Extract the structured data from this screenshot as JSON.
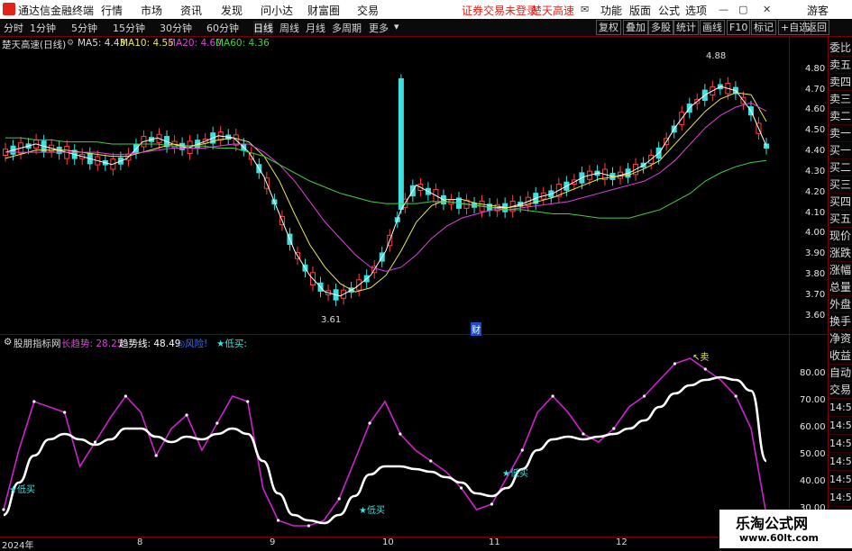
{
  "app": {
    "title": "通达信金融终端",
    "menu": [
      "行情",
      "市场",
      "资讯",
      "发现",
      "问小达",
      "财富圈",
      "交易"
    ],
    "trade_status": "证券交易未登录",
    "stock_name_top": "楚天高速",
    "right_menu": [
      "功能",
      "版面",
      "公式",
      "选项"
    ],
    "user": "游客"
  },
  "toolbar": {
    "periods": [
      "分时",
      "1分钟",
      "5分钟",
      "15分钟",
      "30分钟",
      "60分钟",
      "日线",
      "周线",
      "月线",
      "多周期",
      "更多"
    ],
    "active_period": "日线",
    "right_buttons": [
      "复权",
      "叠加",
      "多股",
      "统计",
      "画线",
      "F10",
      "标记",
      "+自选",
      "返回"
    ]
  },
  "main_chart": {
    "title": "楚天高速(日线)",
    "ma": [
      {
        "label": "MA5: 4.43",
        "color": "#ffffff"
      },
      {
        "label": "MA10: 4.55",
        "color": "#e8e85a"
      },
      {
        "label": "MA20: 4.60",
        "color": "#e040e0"
      },
      {
        "label": "MA60: 4.36",
        "color": "#40d040"
      }
    ],
    "y_ticks": [
      "4.80",
      "4.70",
      "4.60",
      "4.50",
      "4.40",
      "4.30",
      "4.20",
      "4.10",
      "4.00",
      "3.90",
      "3.80",
      "3.70",
      "3.60"
    ],
    "high_label": "4.88",
    "low_label": "3.61",
    "finance_marker": "财"
  },
  "indicator": {
    "name": "股朋指标网",
    "long_trend": "长趋势: 28.25",
    "trend_line": "趋势线: 48.49",
    "flag1": "◎风险!",
    "flag2": "★低买:",
    "y_ticks": [
      "80.00",
      "70.00",
      "60.00",
      "50.00",
      "40.00",
      "30.00"
    ],
    "labels": {
      "buy1": "★低买",
      "buy2": "★低买",
      "buy3": "★低买",
      "sell": "↖卖"
    }
  },
  "side_tabs": [
    "委比",
    "卖五",
    "卖四",
    "卖三",
    "卖二",
    "卖一",
    "买一",
    "买二",
    "买三",
    "买四",
    "买五",
    "现价",
    "涨跌",
    "涨幅",
    "总量",
    "外盘",
    "换手",
    "净资",
    "收益",
    "自动",
    "交易"
  ],
  "side_times": [
    "14:56",
    "14:56",
    "14:56",
    "14:56",
    "14:56",
    "14:56",
    "14:56"
  ],
  "dates": [
    "2024年",
    "8",
    "9",
    "10",
    "11",
    "12"
  ],
  "watermark": {
    "line1": "乐淘公式网",
    "line2": "www.60lt.com"
  },
  "chart_data": [
    {
      "type": "candlestick",
      "title": "楚天高速(日线)",
      "ylim": [
        3.55,
        4.9
      ],
      "series": [
        {
          "name": "MA5",
          "values": [
            4.4,
            4.42,
            4.44,
            4.42,
            4.4,
            4.38,
            4.36,
            4.34,
            4.37,
            4.45,
            4.47,
            4.44,
            4.42,
            4.45,
            4.48,
            4.47,
            4.4,
            4.28,
            4.1,
            3.92,
            3.8,
            3.72,
            3.7,
            3.74,
            3.8,
            3.92,
            4.12,
            4.24,
            4.2,
            4.16,
            4.15,
            4.14,
            4.13,
            4.13,
            4.15,
            4.18,
            4.2,
            4.24,
            4.28,
            4.3,
            4.28,
            4.3,
            4.34,
            4.4,
            4.52,
            4.62,
            4.68,
            4.72,
            4.7,
            4.6,
            4.43
          ]
        },
        {
          "name": "MA10",
          "values": [
            4.37,
            4.39,
            4.41,
            4.41,
            4.41,
            4.4,
            4.39,
            4.38,
            4.38,
            4.4,
            4.42,
            4.44,
            4.43,
            4.44,
            4.46,
            4.47,
            4.45,
            4.38,
            4.26,
            4.1,
            3.95,
            3.84,
            3.76,
            3.72,
            3.74,
            3.8,
            3.92,
            4.06,
            4.14,
            4.17,
            4.17,
            4.15,
            4.14,
            4.13,
            4.14,
            4.16,
            4.18,
            4.21,
            4.24,
            4.27,
            4.28,
            4.29,
            4.32,
            4.36,
            4.44,
            4.52,
            4.6,
            4.66,
            4.69,
            4.68,
            4.55
          ]
        },
        {
          "name": "MA20",
          "values": [
            4.4,
            4.4,
            4.4,
            4.4,
            4.4,
            4.4,
            4.4,
            4.39,
            4.39,
            4.4,
            4.41,
            4.42,
            4.42,
            4.42,
            4.43,
            4.44,
            4.44,
            4.4,
            4.34,
            4.26,
            4.16,
            4.06,
            3.98,
            3.9,
            3.84,
            3.82,
            3.84,
            3.9,
            3.98,
            4.04,
            4.08,
            4.1,
            4.12,
            4.12,
            4.13,
            4.14,
            4.15,
            4.16,
            4.18,
            4.2,
            4.22,
            4.24,
            4.26,
            4.3,
            4.36,
            4.44,
            4.52,
            4.58,
            4.62,
            4.64,
            4.6
          ]
        },
        {
          "name": "MA60",
          "values": [
            4.47,
            4.47,
            4.46,
            4.46,
            4.45,
            4.45,
            4.45,
            4.44,
            4.44,
            4.44,
            4.44,
            4.43,
            4.43,
            4.43,
            4.42,
            4.42,
            4.4,
            4.38,
            4.34,
            4.3,
            4.26,
            4.23,
            4.2,
            4.18,
            4.16,
            4.15,
            4.15,
            4.15,
            4.16,
            4.16,
            4.15,
            4.14,
            4.13,
            4.12,
            4.12,
            4.11,
            4.1,
            4.1,
            4.09,
            4.08,
            4.08,
            4.08,
            4.1,
            4.12,
            4.16,
            4.2,
            4.26,
            4.3,
            4.33,
            4.35,
            4.36
          ]
        }
      ]
    },
    {
      "type": "line",
      "title": "股朋指标网",
      "ylim": [
        22,
        88
      ],
      "series": [
        {
          "name": "长趋势",
          "values": [
            30,
            52,
            70,
            68,
            66,
            46,
            55,
            64,
            72,
            66,
            50,
            60,
            65,
            52,
            62,
            72,
            70,
            38,
            26,
            24,
            24,
            26,
            34,
            48,
            62,
            70,
            58,
            52,
            48,
            44,
            38,
            30,
            32,
            42,
            52,
            66,
            72,
            66,
            58,
            55,
            60,
            68,
            72,
            78,
            84,
            86,
            82,
            78,
            72,
            60,
            28
          ]
        },
        {
          "name": "趋势线",
          "values": [
            28,
            40,
            50,
            56,
            58,
            56,
            54,
            56,
            60,
            60,
            57,
            55,
            57,
            56,
            58,
            60,
            58,
            48,
            36,
            28,
            26,
            25,
            28,
            35,
            43,
            46,
            46,
            45,
            44,
            42,
            40,
            36,
            35,
            38,
            45,
            52,
            56,
            57,
            56,
            57,
            58,
            60,
            63,
            68,
            73,
            76,
            78,
            79,
            78,
            74,
            48
          ]
        }
      ]
    }
  ]
}
